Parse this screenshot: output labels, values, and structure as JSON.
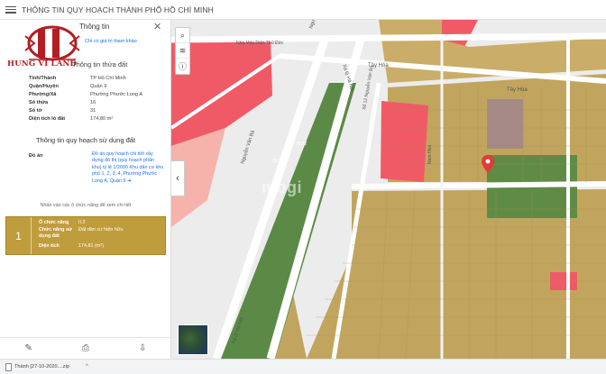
{
  "app": {
    "title": "THÔNG TIN QUY HOẠCH THÀNH PHỐ HỒ CHÍ MINH"
  },
  "logo": {
    "brand": "HUNG VI LAND"
  },
  "panel": {
    "tab_label": "Thông tin",
    "note": "Chỉ có giá trị tham khảo",
    "parcel_section": "Thông tin thửa đất",
    "parcel": [
      {
        "label": "Tỉnh/Thành",
        "value": "TP Hồ Chí Minh"
      },
      {
        "label": "Quận/Huyện",
        "value": "Quận 9"
      },
      {
        "label": "Phường/Xã",
        "value": "Phường Phước Long A"
      },
      {
        "label": "Số thửa",
        "value": "16"
      },
      {
        "label": "Số tờ",
        "value": "31"
      },
      {
        "label": "Diện tích lô đất",
        "value": "174,80 m²"
      }
    ],
    "plan_section": "Thông tin quy hoạch sử dụng đất",
    "plan_label": "Đồ án",
    "plan_value": "Đồ án quy hoạch chi tiết xây dựng đô thị (quy hoạch phân khu) tỷ lệ 1/2000 Khu dân cư khu phố 1, 2, 3, 4, Phường Phước Long A, Quận 9 ➔",
    "hint": "Nhấn vào các ô chức năng để xem chi tiết",
    "card": {
      "index": "1",
      "rows": [
        {
          "label": "Ô chức năng",
          "value": "II.2"
        },
        {
          "label": "Chức năng sử dụng đất",
          "value": "Đất dân cư hiện hữu"
        },
        {
          "label": "Diện tích",
          "value": "174,81 (m²)"
        }
      ]
    }
  },
  "map": {
    "watermark": "mogi",
    "road_labels": {
      "factory": "Nhà Máy Điện Thủ Đức",
      "tay_hoa_1": "Tây Hòa",
      "tay_hoa_2": "Tây Hòa",
      "nguyen_van_ba": "Nguyễn Văn Bá",
      "xa_lo_1": "Xa lộ Hà Nội",
      "xa_lo_2": "Xa lộ Hà Nội",
      "ql52_1": "QL52",
      "ql52_2": "QL52",
      "street_a": "Nguyễn Văn Bá",
      "street_b": "Số 12 Nguyễn Văn Bá",
      "street_c": "Nam Hòa"
    },
    "colors": {
      "residential": "#c1a55f",
      "commercial": "#f05a66",
      "green": "#5a8a45",
      "park": "#5f8b44",
      "road": "#ffffff",
      "institution": "#a68a88"
    }
  },
  "download": {
    "filename": "Thành [27-10-2020....zip",
    "chevron": "^"
  }
}
